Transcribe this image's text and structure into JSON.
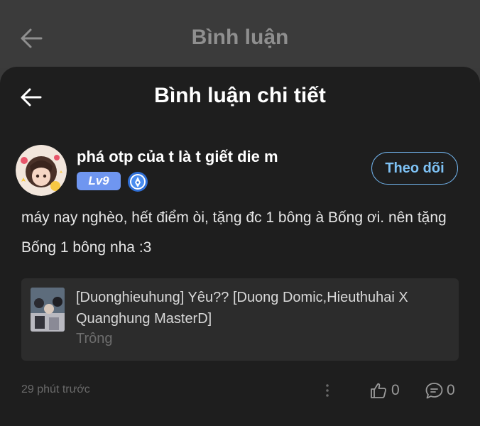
{
  "header": {
    "title": "Bình luận",
    "back_icon": "arrow-left-icon"
  },
  "sheet": {
    "title": "Bình luận chi tiết",
    "back_icon": "arrow-left-icon"
  },
  "comment": {
    "username": "phá otp của t là t giết die m",
    "level": "Lv9",
    "follow_label": "Theo dõi",
    "text": "máy nay nghèo, hết điểm òi, tặng đc 1 bông à Bống ơi. nên tặng Bống 1 bông nha :3",
    "timestamp": "29 phút trước",
    "likes": "0",
    "replies": "0"
  },
  "song": {
    "title": "[Duonghieuhung] Yêu?? [Duong Domic,Hieuthuhai X Quanghung MasterD]",
    "subtitle": "Trông"
  },
  "colors": {
    "accent": "#7ec2f5",
    "badge": "#6f96f0",
    "sheet_bg": "#1e1e1e"
  }
}
